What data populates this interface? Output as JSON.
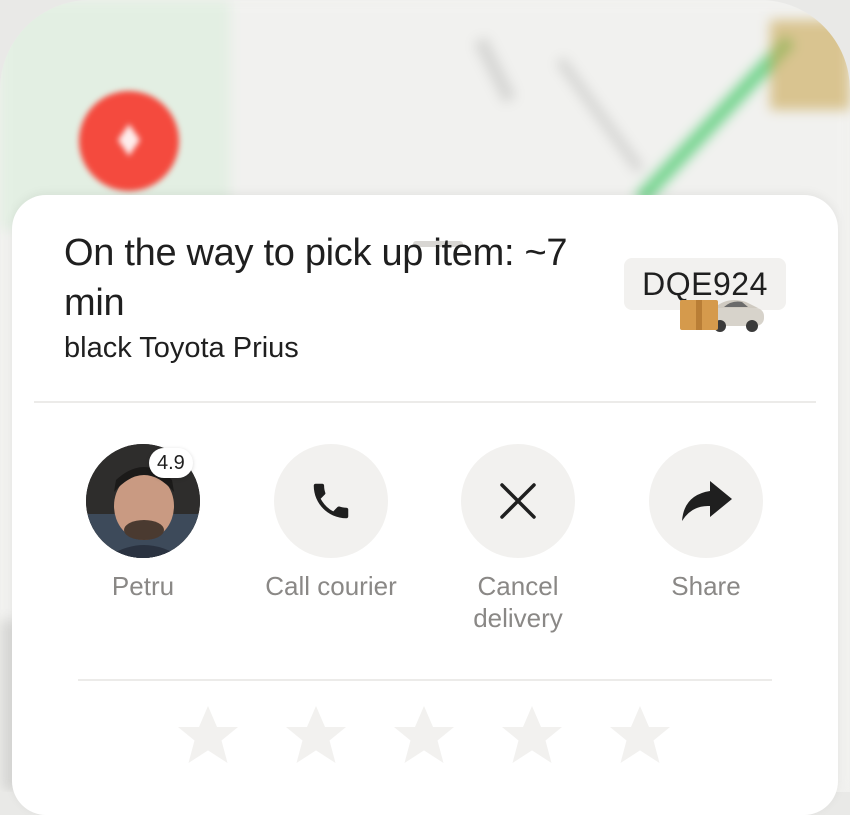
{
  "status": {
    "title": "On the way to pick up item: ~7 min",
    "vehicle": "black Toyota Prius",
    "plate": "DQE924"
  },
  "courier": {
    "name": "Petru",
    "rating": "4.9"
  },
  "actions": [
    {
      "label": "Petru",
      "icon": "avatar"
    },
    {
      "label": "Call courier",
      "icon": "phone-icon"
    },
    {
      "label": "Cancel delivery",
      "icon": "close-icon"
    },
    {
      "label": "Share",
      "icon": "share-arrow-icon"
    }
  ],
  "rating_stars": {
    "count": 5,
    "filled": 0
  },
  "colors": {
    "accent_red": "#f44a3e",
    "route_green": "#5fd07a",
    "surface_grey": "#f2f1ef",
    "text_primary": "#1f1f1f",
    "text_secondary": "#8a8886"
  }
}
